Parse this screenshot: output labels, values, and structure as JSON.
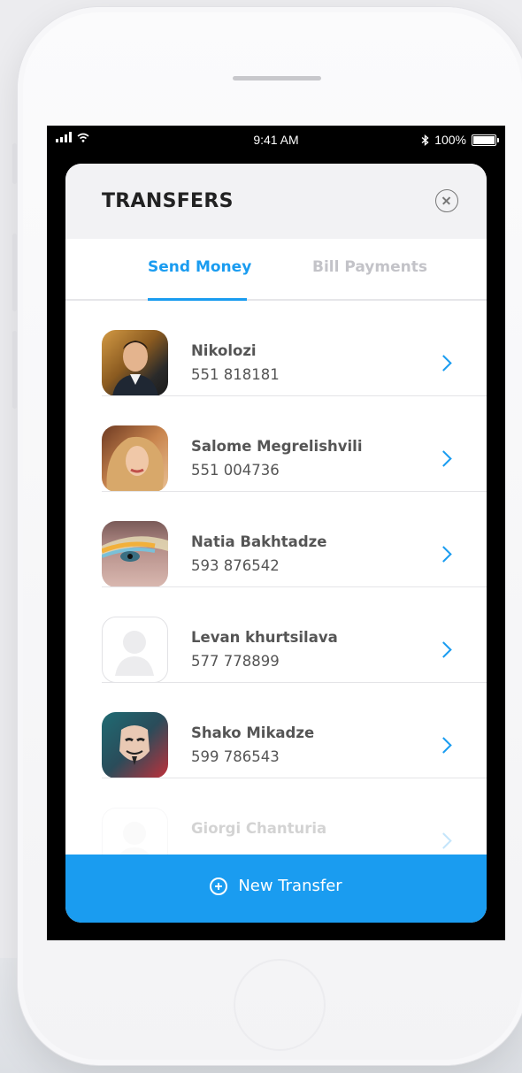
{
  "status_bar": {
    "time": "9:41 AM",
    "battery": "100%"
  },
  "header": {
    "title": "TRANSFERS"
  },
  "tabs": [
    {
      "label": "Send Money",
      "active": true
    },
    {
      "label": "Bill Payments",
      "active": false
    }
  ],
  "contacts": [
    {
      "name": "Nikolozi",
      "phone": "551 818181",
      "avatar": "photo"
    },
    {
      "name": "Salome Megrelishvili",
      "phone": "551 004736",
      "avatar": "photo"
    },
    {
      "name": "Natia Bakhtadze",
      "phone": "593 876542",
      "avatar": "photo"
    },
    {
      "name": "Levan khurtsilava",
      "phone": "577 778899",
      "avatar": "placeholder"
    },
    {
      "name": "Shako Mikadze",
      "phone": "599 786543",
      "avatar": "photo"
    },
    {
      "name": "Giorgi Chanturia",
      "phone": "",
      "avatar": "placeholder"
    }
  ],
  "footer": {
    "new_transfer_label": "New Transfer"
  },
  "colors": {
    "accent": "#1a9cf0",
    "header_bg": "#f2f2f4",
    "text": "#555555"
  }
}
